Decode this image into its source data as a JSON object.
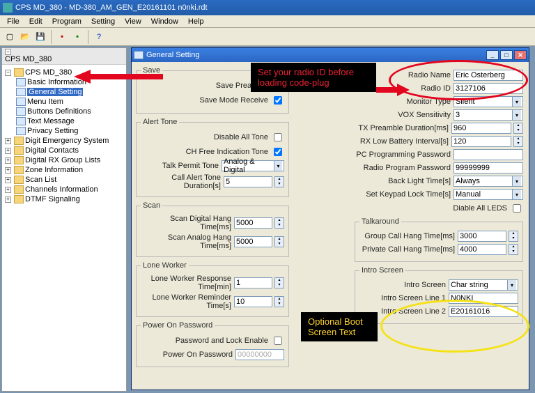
{
  "window": {
    "title": "CPS MD_380 - MD-380_AM_GEN_E20161101 n0nki.rdt"
  },
  "menu": {
    "items": [
      "File",
      "Edit",
      "Program",
      "Setting",
      "View",
      "Window",
      "Help"
    ]
  },
  "tree": {
    "header": "CPS MD_380",
    "root": "CPS MD_380",
    "items": [
      {
        "label": "Basic Information"
      },
      {
        "label": "General Setting",
        "selected": true
      },
      {
        "label": "Menu Item"
      },
      {
        "label": "Buttons Definitions"
      },
      {
        "label": "Text Message"
      },
      {
        "label": "Privacy Setting"
      },
      {
        "label": "Digit Emergency System",
        "expandable": true
      },
      {
        "label": "Digital Contacts",
        "expandable": true
      },
      {
        "label": "Digital RX Group Lists",
        "expandable": true
      },
      {
        "label": "Zone Information",
        "expandable": true
      },
      {
        "label": "Scan List",
        "expandable": true
      },
      {
        "label": "Channels Information",
        "expandable": true
      },
      {
        "label": "DTMF Signaling",
        "expandable": true
      }
    ]
  },
  "mdi": {
    "title": "General Setting"
  },
  "save": {
    "legend": "Save",
    "preamble_label": "Save Preamble",
    "preamble_checked": true,
    "mode_rx_label": "Save Mode Receive",
    "mode_rx_checked": true
  },
  "alert": {
    "legend": "Alert Tone",
    "disable_all_label": "Disable All Tone",
    "disable_all_checked": false,
    "ch_free_label": "CH Free Indication Tone",
    "ch_free_checked": true,
    "talk_permit_label": "Talk Permit Tone",
    "talk_permit_value": "Analog & Digital",
    "call_alert_label": "Call Alert Tone Duration[s]",
    "call_alert_value": "5"
  },
  "scan": {
    "legend": "Scan",
    "digital_label": "Scan Digital Hang Time[ms]",
    "digital_value": "5000",
    "analog_label": "Scan Analog Hang Time[ms]",
    "analog_value": "5000"
  },
  "lone": {
    "legend": "Lone Worker",
    "response_label": "Lone Worker Response Time[min]",
    "response_value": "1",
    "reminder_label": "Lone Worker Reminder Time[s]",
    "reminder_value": "10"
  },
  "power": {
    "legend": "Power On Password",
    "enable_label": "Password and Lock Enable",
    "enable_checked": false,
    "pw_label": "Power On Password",
    "pw_value": "00000000"
  },
  "right": {
    "radio_name_label": "Radio Name",
    "radio_name_value": "Eric Osterberg",
    "radio_id_label": "Radio ID",
    "radio_id_value": "3127106",
    "monitor_label": "Monitor Type",
    "monitor_value": "Silent",
    "vox_label": "VOX Sensitivity",
    "vox_value": "3",
    "tx_preamble_label": "TX Preamble Duration[ms]",
    "tx_preamble_value": "960",
    "rx_lowbat_label": "RX Low Battery Interval[s]",
    "rx_lowbat_value": "120",
    "pc_pw_label": "PC Programming Password",
    "pc_pw_value": "",
    "radio_pw_label": "Radio Program Password",
    "radio_pw_value": "99999999",
    "backlight_label": "Back Light Time[s]",
    "backlight_value": "Always",
    "keypad_label": "Set Keypad Lock Time[s]",
    "keypad_value": "Manual",
    "disable_leds_label": "Diable All LEDS",
    "disable_leds_checked": false
  },
  "talkaround": {
    "legend": "Talkaround",
    "group_label": "Group Call Hang Time[ms]",
    "group_value": "3000",
    "private_label": "Private Call Hang Time[ms]",
    "private_value": "4000"
  },
  "intro": {
    "legend": "Intro Screen",
    "intro_label": "Intro Screen",
    "intro_value": "Char string",
    "line1_label": "Intro Screen Line 1",
    "line1_value": "N0NKI",
    "line2_label": "Intro Screen Line 2",
    "line2_value": "E20161016"
  },
  "annotations": {
    "red_text": "Set your radio ID before loading code-plug",
    "yellow_text": "Optional Boot Screen Text"
  }
}
